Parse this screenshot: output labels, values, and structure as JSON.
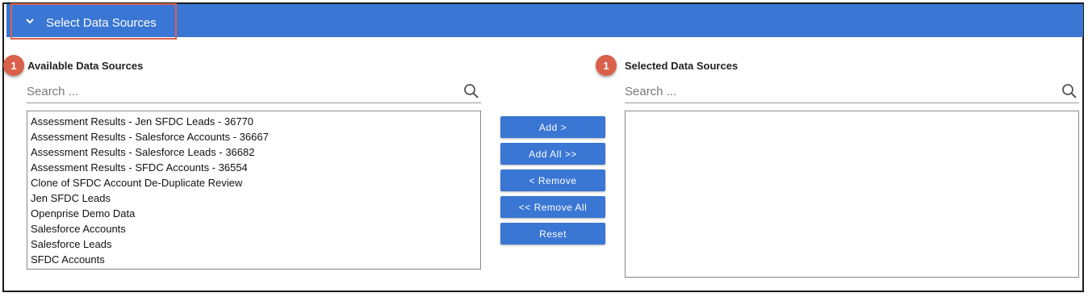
{
  "header": {
    "title": "Select Data Sources",
    "toggle_icon": "chevron-down-icon",
    "color": "#3a76d4",
    "highlight_color": "#d9604a"
  },
  "available": {
    "badge": "1",
    "label": "Available Data Sources",
    "search": {
      "placeholder": "Search ...",
      "value": "",
      "icon": "search-icon"
    },
    "items": [
      "Assessment Results - Jen SFDC Leads - 36770",
      "Assessment Results - Salesforce Accounts - 36667",
      "Assessment Results - Salesforce Leads - 36682",
      "Assessment Results - SFDC Accounts - 36554",
      "Clone of SFDC Account De-Duplicate Review",
      "Jen SFDC Leads",
      "Openprise Demo Data",
      "Salesforce Accounts",
      "Salesforce Leads",
      "SFDC Accounts"
    ]
  },
  "selected": {
    "badge": "1",
    "label": "Selected Data Sources",
    "search": {
      "placeholder": "Search ...",
      "value": "",
      "icon": "search-icon"
    },
    "items": []
  },
  "actions": {
    "add": "Add >",
    "add_all": "Add All >>",
    "remove": "< Remove",
    "remove_all": "<< Remove All",
    "reset": "Reset",
    "button_color": "#3a76d4"
  }
}
